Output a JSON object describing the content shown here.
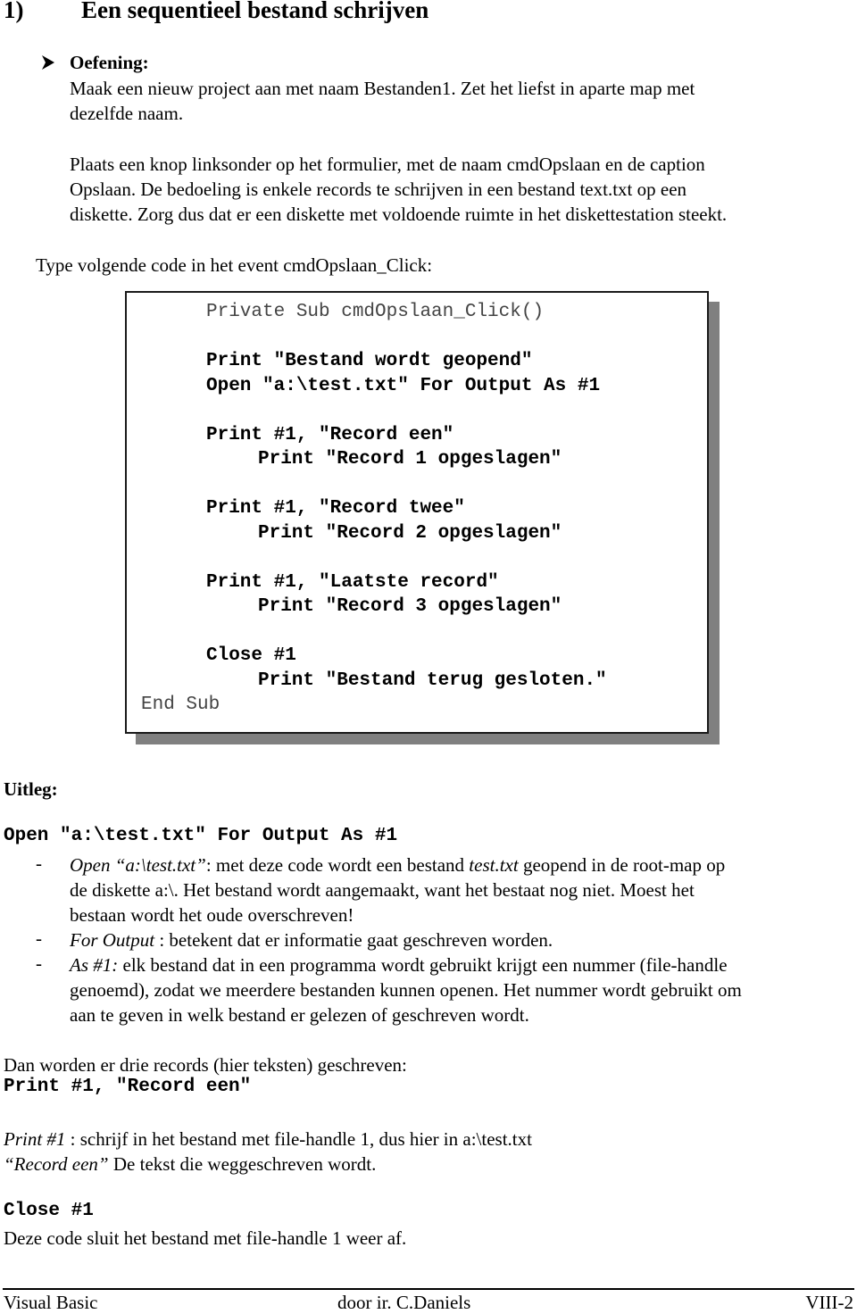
{
  "heading": {
    "number": "1)",
    "title": "Een sequentieel bestand schrijven"
  },
  "exercise": {
    "bullet_icon": "arrowhead-bullet-icon",
    "label": "Oefening:",
    "lines": [
      "Maak een nieuw project aan met naam Bestanden1. Zet het liefst in aparte map met",
      "dezelfde naam.",
      "Plaats een knop linksonder op het formulier, met de naam cmdOpslaan en de caption",
      "Opslaan. De bedoeling is enkele records te schrijven in een bestand text.txt op een",
      "diskette. Zorg dus dat er een diskette met voldoende ruimte in het diskettestation steekt."
    ]
  },
  "intro": "Type volgende code in het event cmdOpslaan_Click:",
  "code_block": {
    "lines": [
      {
        "text": "Private Sub cmdOpslaan_Click()",
        "style": "light",
        "indent": 1
      },
      {
        "text": "",
        "style": "blank",
        "indent": 0
      },
      {
        "text": "Print \"Bestand wordt geopend\"",
        "style": "bold",
        "indent": 1
      },
      {
        "text": "Open \"a:\\test.txt\" For Output As #1",
        "style": "bold",
        "indent": 1
      },
      {
        "text": "",
        "style": "blank",
        "indent": 0
      },
      {
        "text": "Print #1, \"Record een\"",
        "style": "bold",
        "indent": 1
      },
      {
        "text": "Print \"Record 1 opgeslagen\"",
        "style": "bold",
        "indent": 2
      },
      {
        "text": "",
        "style": "blank",
        "indent": 0
      },
      {
        "text": "Print #1, \"Record twee\"",
        "style": "bold",
        "indent": 1
      },
      {
        "text": "Print \"Record 2 opgeslagen\"",
        "style": "bold",
        "indent": 2
      },
      {
        "text": "",
        "style": "blank",
        "indent": 0
      },
      {
        "text": "Print #1, \"Laatste record\"",
        "style": "bold",
        "indent": 1
      },
      {
        "text": "Print \"Record 3 opgeslagen\"",
        "style": "bold",
        "indent": 2
      },
      {
        "text": "",
        "style": "blank",
        "indent": 0
      },
      {
        "text": "Close #1",
        "style": "bold",
        "indent": 1
      },
      {
        "text": "Print \"Bestand terug gesloten.\"",
        "style": "bold",
        "indent": 2
      },
      {
        "text": "End Sub",
        "style": "light",
        "indent": 0
      }
    ]
  },
  "uitleg": {
    "label": "Uitleg:",
    "code_line": "Open \"a:\\test.txt\" For Output As #1",
    "bullets": [
      {
        "dash": "-",
        "term": "Open “a:\\test.txt”",
        "rest_lines": [
          ": met deze code wordt een bestand ",
          "test.txt",
          " geopend in de root-map op"
        ],
        "continuation": [
          "de diskette a:\\. Het bestand wordt aangemaakt, want het bestaat nog niet. Moest het",
          "bestaan wordt het oude overschreven!"
        ]
      },
      {
        "dash": "-",
        "term": "For Output",
        "rest": " : betekent dat er informatie gaat geschreven worden."
      },
      {
        "dash": "-",
        "term": "As #1:",
        "rest": " elk bestand dat in een programma wordt gebruikt krijgt een nummer (file-handle",
        "continuation": [
          "genoemd), zodat we meerdere bestanden kunnen openen. Het nummer wordt gebruikt om",
          "aan te geven in welk bestand er gelezen of geschreven wordt."
        ]
      }
    ]
  },
  "records": {
    "intro": "Dan worden er drie records (hier teksten) geschreven:",
    "code_line": "Print #1, \"Record een\"",
    "explain": [
      {
        "term": "Print #1",
        "rest": " : schrijf in het bestand met file-handle 1, dus hier in a:\\test.txt"
      },
      {
        "term": "“Record een”",
        "rest": " De tekst die weggeschreven wordt."
      }
    ]
  },
  "close": {
    "code_line": "Close #1",
    "text": "Deze code sluit het bestand met file-handle 1 weer af."
  },
  "footer": {
    "left": "Visual Basic",
    "center": "door ir. C.Daniels",
    "right": "VIII-2"
  }
}
